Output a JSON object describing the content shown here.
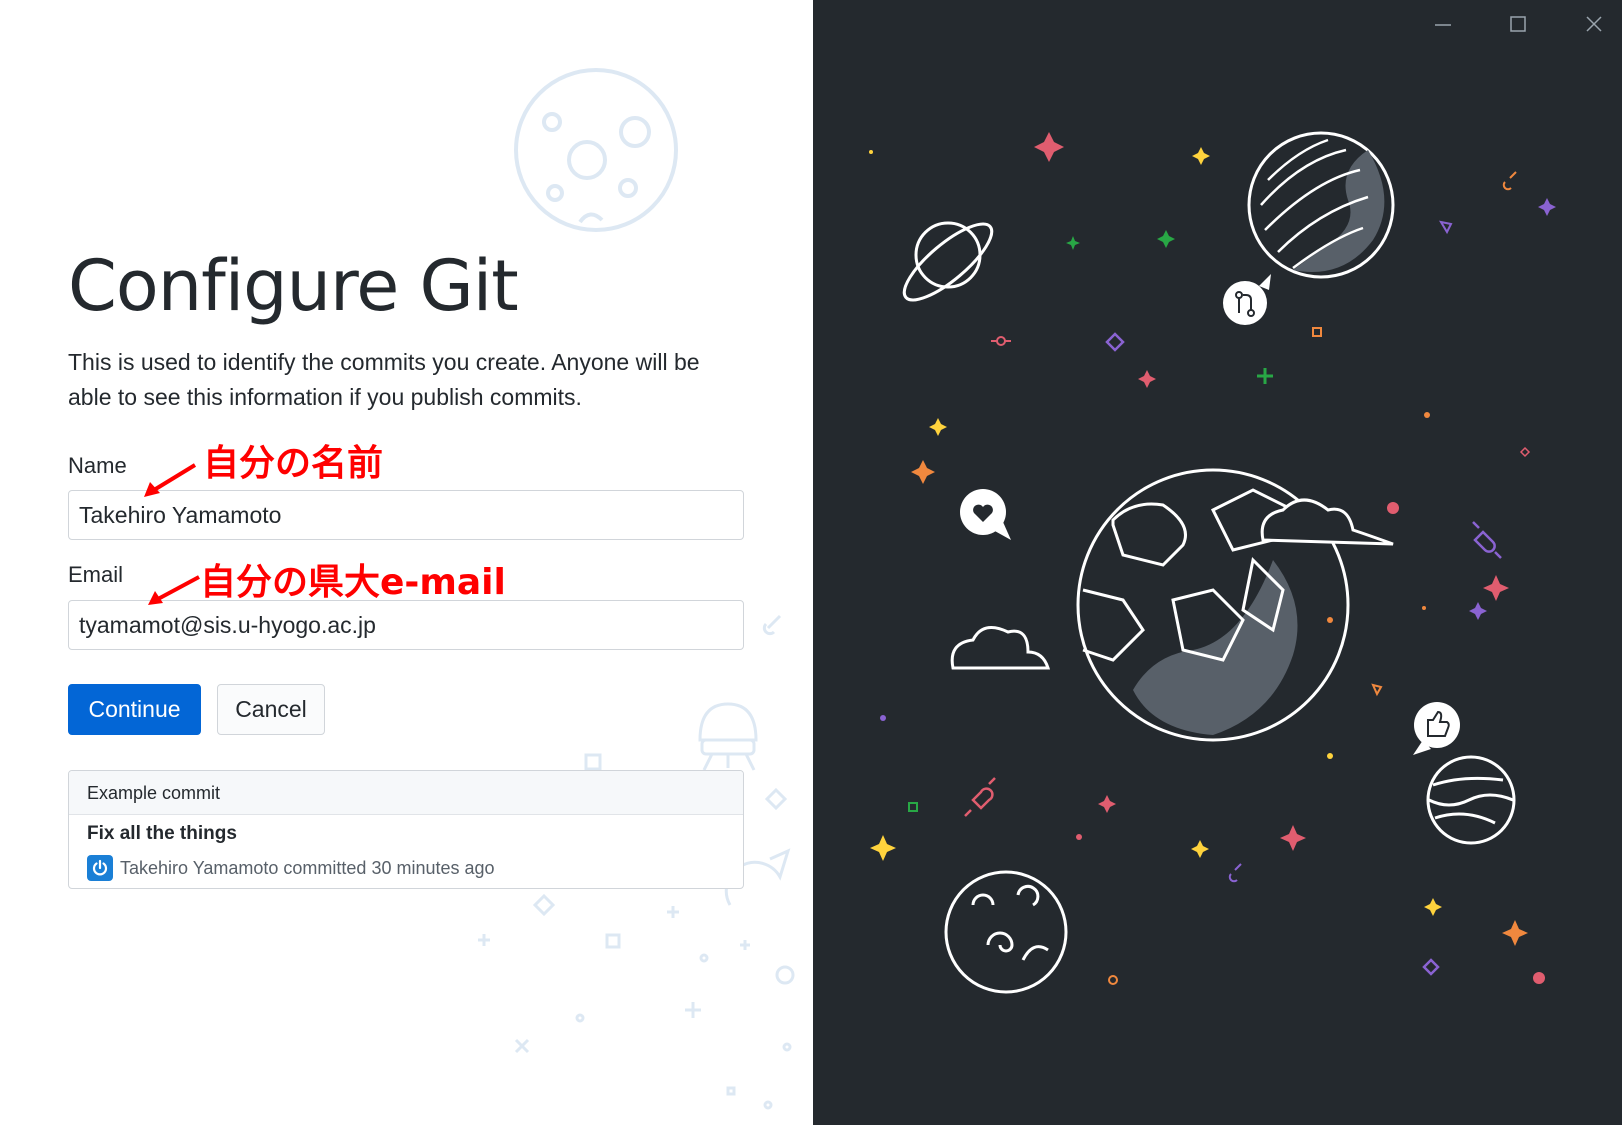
{
  "page": {
    "title": "Configure Git",
    "description": "This is used to identify the commits you create. Anyone will be able to see this information if you publish commits."
  },
  "form": {
    "name_label": "Name",
    "name_value": "Takehiro Yamamoto",
    "email_label": "Email",
    "email_value": "tyamamot@sis.u-hyogo.ac.jp"
  },
  "buttons": {
    "continue": "Continue",
    "cancel": "Cancel"
  },
  "example_commit": {
    "header": "Example commit",
    "summary": "Fix all the things",
    "meta": "Takehiro Yamamoto committed 30 minutes ago"
  },
  "annotations": {
    "name_note": "自分の名前",
    "email_note": "自分の県大e-mail",
    "color": "#ff0000"
  },
  "window_controls": {
    "minimize": "minimize-icon",
    "maximize": "maximize-icon",
    "close": "close-icon"
  },
  "colors": {
    "primary": "#0366d6",
    "sidebar_bg": "#24292e"
  }
}
